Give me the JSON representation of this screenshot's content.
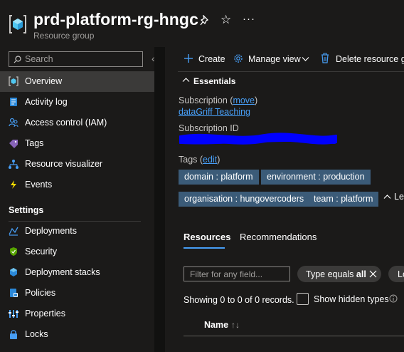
{
  "header": {
    "title": "prd-platform-rg-hngc",
    "subtitle": "Resource group",
    "more_label": "···"
  },
  "sidebar": {
    "search_placeholder": "Search",
    "collapse_label": "«",
    "items": [
      {
        "label": "Overview",
        "icon": "resource-group-icon"
      },
      {
        "label": "Activity log",
        "icon": "activity-log-icon"
      },
      {
        "label": "Access control (IAM)",
        "icon": "people-icon"
      },
      {
        "label": "Tags",
        "icon": "tag-icon"
      },
      {
        "label": "Resource visualizer",
        "icon": "visualizer-icon"
      },
      {
        "label": "Events",
        "icon": "lightning-icon"
      }
    ],
    "settings_heading": "Settings",
    "settings_items": [
      {
        "label": "Deployments",
        "icon": "deployments-icon"
      },
      {
        "label": "Security",
        "icon": "shield-icon"
      },
      {
        "label": "Deployment stacks",
        "icon": "stack-icon"
      },
      {
        "label": "Policies",
        "icon": "policy-icon"
      },
      {
        "label": "Properties",
        "icon": "properties-icon"
      },
      {
        "label": "Locks",
        "icon": "lock-icon"
      }
    ]
  },
  "commandbar": {
    "create": "Create",
    "manage_view": "Manage view",
    "delete": "Delete resource gro"
  },
  "essentials": {
    "heading": "Essentials",
    "subscription_label": "Subscription",
    "move_link": "move",
    "subscription_value": "dataGriff Teaching",
    "subscription_id_label": "Subscription ID",
    "tags_label": "Tags",
    "edit_link": "edit",
    "tags": [
      "domain : platform",
      "environment : production",
      "organisation : hungovercoders",
      "team : platform"
    ],
    "less_label": "Les"
  },
  "tabs": {
    "resources": "Resources",
    "recommendations": "Recommendations"
  },
  "filter": {
    "placeholder": "Filter for any field...",
    "type_pill_prefix": "Type equals ",
    "type_pill_value": "all",
    "location_pill": "Lo"
  },
  "records": {
    "text": "Showing 0 to 0 of 0 records.",
    "show_hidden": "Show hidden types"
  },
  "table": {
    "name_header": "Name"
  },
  "colors": {
    "accent": "#479ef5",
    "tag_bg": "#3b5b78",
    "background": "#1b1a19",
    "redaction": "#0000ff"
  }
}
